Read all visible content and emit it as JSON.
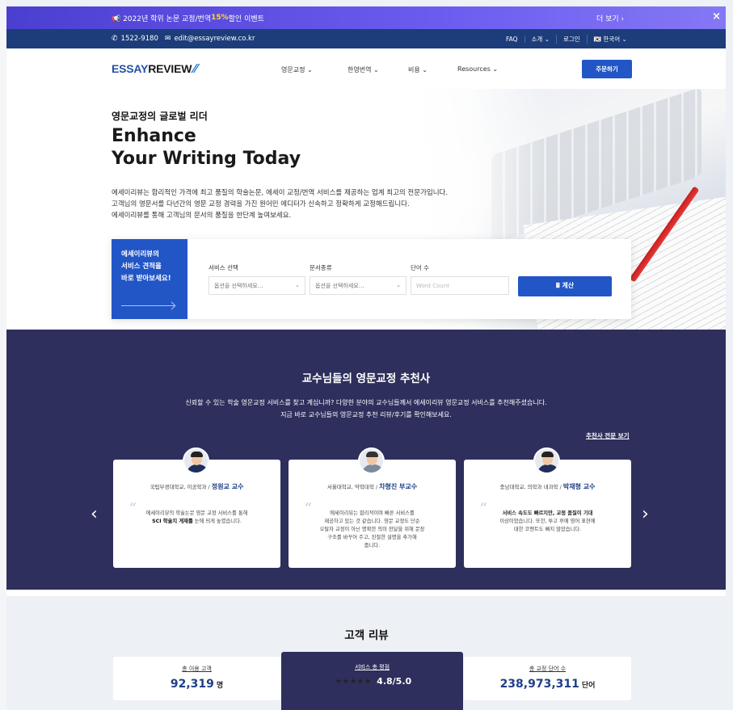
{
  "promo": {
    "text_pre": "📢 2022년 학위 논문 교정/번역 ",
    "highlight": "15%",
    "text_post": " 할인 이벤트",
    "more": "더 보기 ›",
    "close": "×"
  },
  "contact": {
    "phone": "1522-9180",
    "email": "edit@essayreview.co.kr",
    "links": [
      "FAQ",
      "소개 ⌄",
      "로그인",
      "🇰🇷 한국어 ⌄"
    ]
  },
  "nav": {
    "logo_a": "ESSAY",
    "logo_b": "REVIEW",
    "menu": [
      "영문교정 ⌄",
      "한영번역 ⌄",
      "비용 ⌄",
      "Resources ⌄"
    ],
    "order": "주문하기"
  },
  "hero": {
    "subtitle": "영문교정의 글로벌 리더",
    "title1": "Enhance",
    "title2": "Your Writing Today",
    "desc1": "에세이리뷰는 합리적인 가격에 최고 품질의 학술논문, 에세이 교정/번역 서비스를 제공하는 업계 최고의 전문가입니다.",
    "desc2": "고객님의 영문서를 다년간의 영문 교정 경력을 가진 원어민 에디터가 신속하고 정확하게 교정해드립니다.",
    "desc3": "에세이리뷰를 통해 고객님의 문서의 품질을 한단계 높여보세요."
  },
  "quote": {
    "headline1": "에세이리뷰의",
    "headline2": "서비스 견적을",
    "headline3": "바로 받아보세요!",
    "service_label": "서비스 선택",
    "service_value": "옵션을 선택하세요…",
    "doc_label": "문서종류",
    "doc_value": "옵션을 선택하세요…",
    "words_label": "단어 수",
    "words_placeholder": "Word Count",
    "calc": "🖩 계산"
  },
  "reco": {
    "title": "교수님들의 영문교정 추천사",
    "desc1": "신뢰할 수 있는 학술 영문교정 서비스를 찾고 계십니까? 다양한 분야의 교수님들께서 에세이리뷰 영문교정 서비스를 추천해주셨습니다.",
    "desc2": "지금 바로 교수님들의 영문교정 추천 리뷰/후기를 확인해보세요.",
    "more": "추천사 전문 보기",
    "prev": "‹",
    "next": "›",
    "cards": [
      {
        "inst": "국립부경대학교, 이공학과 / ",
        "name": "정원교 교수",
        "text1": "에세이리뷰의 학술논문 영문 교정 서비스를 통해",
        "text2": "SCI 학술지 게재를",
        "text3": " 눈에 띄게 높였습니다."
      },
      {
        "inst": "서울대학교, 약학대학 / ",
        "name": "차형진 부교수",
        "text1": "에세이리뷰는 합리적이며 빠른 서비스를",
        "text2": "제공하고 있는 것 같습니다. 영문 교정도 단순",
        "text3": "오탈자 교정이 아닌 명확한 의미 전달을 위해 문장",
        "text4": "구조를 바꾸어 주고, 친절한 설명을 추가해",
        "text5": "줍니다."
      },
      {
        "inst": "충남대학교, 의학과 내과학 / ",
        "name": "박재형 교수",
        "text1": "서비스 속도도 빠르지만, 교정 품질이 기대",
        "text2": "이상이었습니다. 또한, 투고 후에 영어 표현에",
        "text3": "대한 코멘트도 빠지 않았습니다."
      }
    ]
  },
  "reviews": {
    "title": "고객 리뷰",
    "stats": [
      {
        "label": "총 이용 고객",
        "value": "92,319",
        "unit": "명"
      },
      {
        "label": "서비스 총 평점",
        "stars": "★★★★★",
        "value": "4.8/5.0"
      },
      {
        "label": "총 교정 단어 수",
        "value": "238,973,311",
        "unit": "단어"
      }
    ]
  },
  "colors": {
    "brand_blue": "#2256c6",
    "navy_bar": "#1c3d7a",
    "dark_section": "#2e2f5c",
    "promo_purple": "#5b4ee0",
    "star": "#f5b800"
  }
}
